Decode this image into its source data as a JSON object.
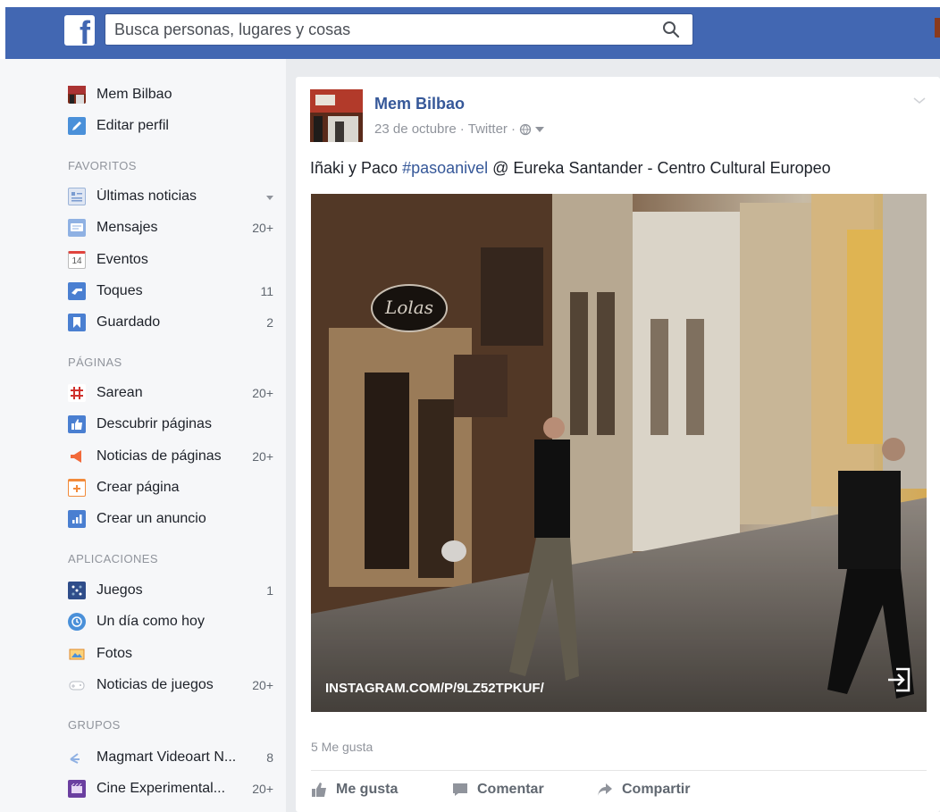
{
  "header": {
    "logo_letter": "f",
    "search_placeholder": "Busca personas, lugares y cosas"
  },
  "sidebar": {
    "profile": [
      {
        "label": "Mem Bilbao"
      },
      {
        "label": "Editar perfil"
      }
    ],
    "sections": {
      "favoritos": "FAVORITOS",
      "paginas": "PÁGINAS",
      "aplicaciones": "APLICACIONES",
      "grupos": "GRUPOS"
    },
    "favoritos": [
      {
        "label": "Últimas noticias",
        "count": ""
      },
      {
        "label": "Mensajes",
        "count": "20+"
      },
      {
        "label": "Eventos",
        "count": "",
        "icon_text": "14"
      },
      {
        "label": "Toques",
        "count": "11"
      },
      {
        "label": "Guardado",
        "count": "2"
      }
    ],
    "paginas": [
      {
        "label": "Sarean",
        "count": "20+"
      },
      {
        "label": "Descubrir páginas",
        "count": ""
      },
      {
        "label": "Noticias de páginas",
        "count": "20+"
      },
      {
        "label": "Crear página",
        "count": ""
      },
      {
        "label": "Crear un anuncio",
        "count": ""
      }
    ],
    "aplicaciones": [
      {
        "label": "Juegos",
        "count": "1"
      },
      {
        "label": "Un día como hoy",
        "count": ""
      },
      {
        "label": "Fotos",
        "count": ""
      },
      {
        "label": "Noticias de juegos",
        "count": "20+"
      }
    ],
    "grupos": [
      {
        "label": "Magmart Videoart N...",
        "count": "8"
      },
      {
        "label": "Cine Experimental...",
        "count": "20+"
      }
    ]
  },
  "post": {
    "author": "Mem Bilbao",
    "date": "23 de octubre",
    "source": "Twitter",
    "separator": "·",
    "text_before": "Iñaki y Paco ",
    "hashtag": "#pasoanivel",
    "text_after": " @ Eureka Santander - Centro Cultural Europeo",
    "photo_caption": "INSTAGRAM.COM/P/9LZ52TPKUF/",
    "sign_text": "Lolas",
    "likes": "5 Me gusta",
    "actions": {
      "like": "Me gusta",
      "comment": "Comentar",
      "share": "Compartir"
    }
  }
}
